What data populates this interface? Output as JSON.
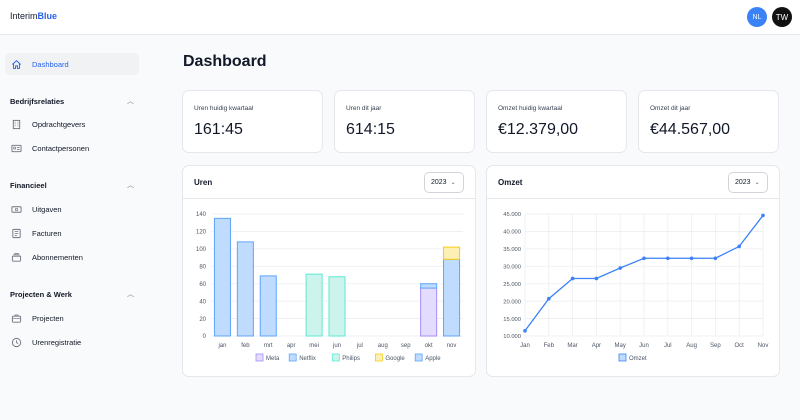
{
  "app": {
    "logo_part1": "Interim",
    "logo_part2": "Blue",
    "accent": "#2563eb"
  },
  "user": {
    "avatar_nl": "NL",
    "avatar_tw": "TW"
  },
  "sidebar": {
    "dashboard": "Dashboard",
    "section_bedrijfsrelaties": "Bedrijfsrelaties",
    "opdrachtgevers": "Opdrachtgevers",
    "contactpersonen": "Contactpersonen",
    "section_financieel": "Financieel",
    "uitgaven": "Uitgaven",
    "facturen": "Facturen",
    "abonnementen": "Abonnementen",
    "section_projecten": "Projecten & Werk",
    "projecten": "Projecten",
    "urenregistratie": "Urenregistratie"
  },
  "page": {
    "title": "Dashboard"
  },
  "stats": [
    {
      "label": "Uren huidig kwartaal",
      "value": "161:45"
    },
    {
      "label": "Uren dit jaar",
      "value": "614:15"
    },
    {
      "label": "Omzet huidig kwartaal",
      "value": "€12.379,00"
    },
    {
      "label": "Omzet dit jaar",
      "value": "€44.567,00"
    }
  ],
  "uren_card": {
    "title": "Uren",
    "year": "2023"
  },
  "omzet_card": {
    "title": "Omzet",
    "year": "2023"
  },
  "chart_data": [
    {
      "type": "bar",
      "title": "Uren",
      "categories": [
        "jan",
        "feb",
        "mrt",
        "apr",
        "mei",
        "jun",
        "jul",
        "aug",
        "sep",
        "okt",
        "nov"
      ],
      "y_ticks": [
        0,
        20,
        40,
        60,
        80,
        100,
        120,
        140
      ],
      "ylim": [
        0,
        140
      ],
      "stacked": true,
      "series": [
        {
          "name": "Meta",
          "color": "#a78bfa",
          "fill": "#e4dcfd",
          "values": [
            0,
            0,
            0,
            0,
            0,
            0,
            0,
            0,
            0,
            55,
            0
          ]
        },
        {
          "name": "Netflix",
          "color": "#60a5fa",
          "fill": "#bfdbfe",
          "values": [
            135,
            108,
            69,
            0,
            0,
            0,
            0,
            0,
            0,
            5,
            88
          ]
        },
        {
          "name": "Philips",
          "color": "#5eead4",
          "fill": "#ccf3ec",
          "values": [
            0,
            0,
            0,
            0,
            71,
            68,
            0,
            0,
            0,
            0,
            0
          ]
        },
        {
          "name": "Google",
          "color": "#facc15",
          "fill": "#fdf0b4",
          "values": [
            0,
            0,
            0,
            0,
            0,
            0,
            0,
            0,
            0,
            0,
            14
          ]
        },
        {
          "name": "Apple",
          "color": "#60a5fa",
          "fill": "#bfdbfe",
          "values": [
            0,
            0,
            0,
            0,
            0,
            0,
            0,
            0,
            0,
            0,
            0
          ]
        }
      ],
      "legend_position": "bottom-center",
      "grid": true
    },
    {
      "type": "line",
      "title": "Omzet",
      "x": [
        "Jan",
        "Feb",
        "Mar",
        "Apr",
        "May",
        "Jun",
        "Jul",
        "Aug",
        "Sep",
        "Oct",
        "Nov"
      ],
      "y_ticks": [
        "10.000",
        "15.000",
        "20.000",
        "25.000",
        "30.000",
        "35.000",
        "40.000",
        "45.000"
      ],
      "y_tick_values": [
        10000,
        15000,
        20000,
        25000,
        30000,
        35000,
        40000,
        45000
      ],
      "ylim": [
        10000,
        45000
      ],
      "series": [
        {
          "name": "Omzet",
          "color": "#3b82f6",
          "values": [
            11500,
            20700,
            26500,
            26500,
            29500,
            32300,
            32300,
            32300,
            32300,
            35700,
            44600
          ]
        }
      ],
      "legend_position": "bottom-center",
      "grid": true
    }
  ]
}
